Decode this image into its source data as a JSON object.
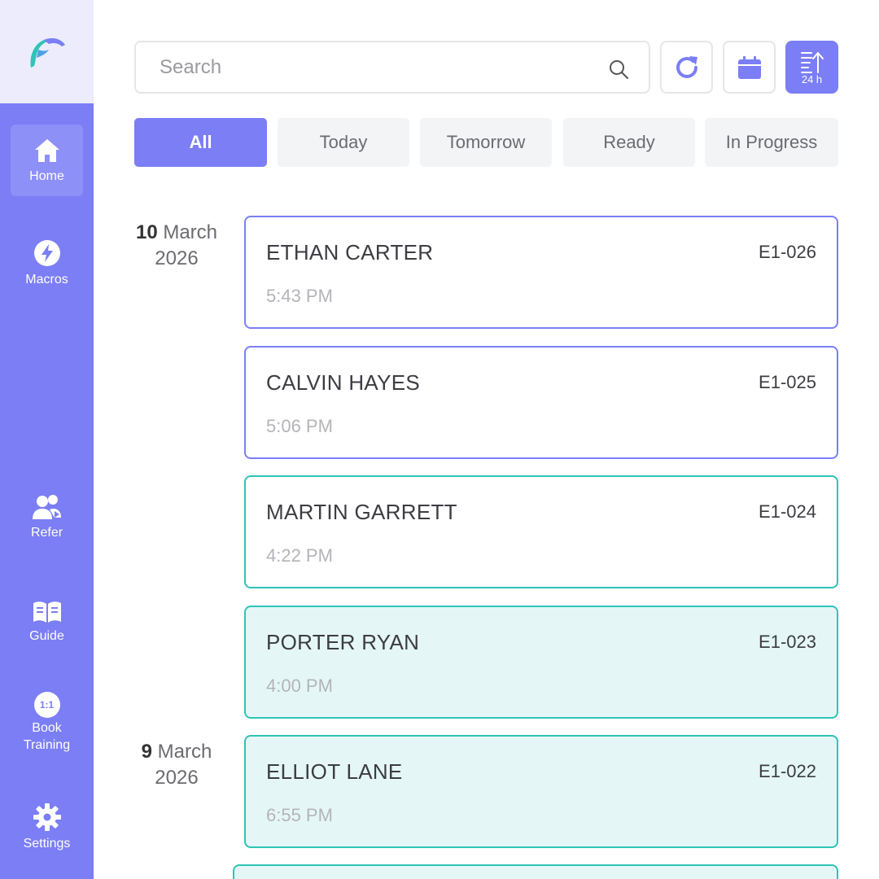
{
  "sidebar": {
    "items": [
      {
        "label": "Home",
        "icon": "home-icon",
        "active": true
      },
      {
        "label": "Macros",
        "icon": "lightning-icon"
      },
      {
        "label": "Refer",
        "icon": "users-icon"
      },
      {
        "label": "Guide",
        "icon": "book-icon"
      },
      {
        "label": "Book Training",
        "icon_text": "1:1"
      },
      {
        "label": "Settings",
        "icon": "gear-icon"
      }
    ]
  },
  "search": {
    "placeholder": "Search",
    "value": ""
  },
  "toolbar": {
    "sort_label": "24 h"
  },
  "tabs": [
    {
      "label": "All",
      "active": true
    },
    {
      "label": "Today"
    },
    {
      "label": "Tomorrow"
    },
    {
      "label": "Ready"
    },
    {
      "label": "In Progress"
    }
  ],
  "groups": [
    {
      "day": "10",
      "month": "March",
      "year": "2026"
    },
    {
      "day": "9",
      "month": "March",
      "year": "2026"
    }
  ],
  "orders": [
    {
      "name": "ETHAN CARTER",
      "code": "E1-026",
      "time": "5:43 PM"
    },
    {
      "name": "CALVIN HAYES",
      "code": "E1-025",
      "time": "5:06 PM"
    },
    {
      "name": "MARTIN GARRETT",
      "code": "E1-024",
      "time": "4:22 PM"
    },
    {
      "name": "PORTER RYAN",
      "code": "E1-023",
      "time": "4:00 PM"
    },
    {
      "name": "ELLIOT LANE",
      "code": "E1-022",
      "time": "6:55 PM"
    }
  ],
  "colors": {
    "accent": "#7b7ef5",
    "teal": "#2ec4b6",
    "teal_fill": "#e4f7f6"
  }
}
